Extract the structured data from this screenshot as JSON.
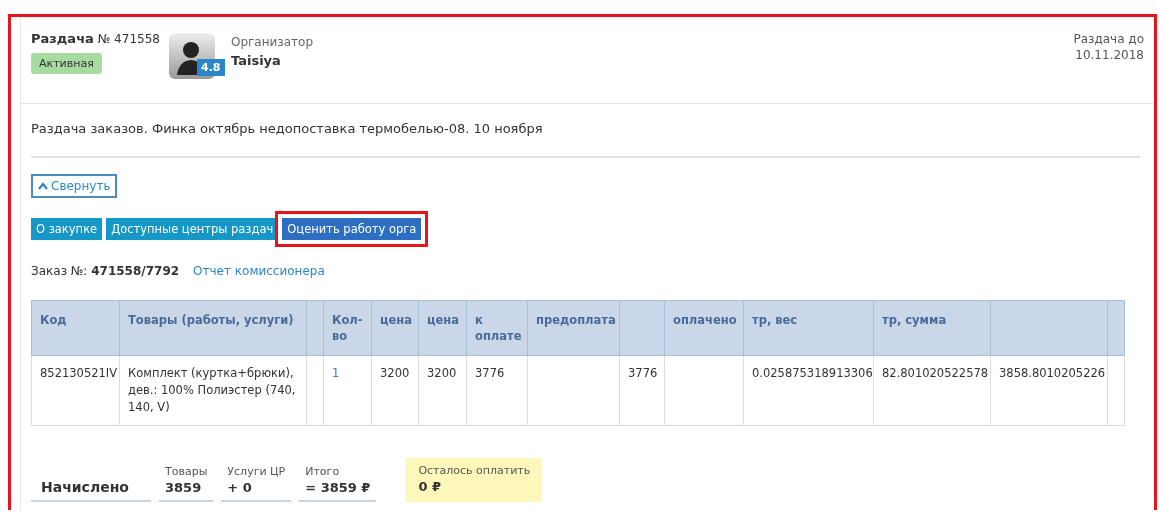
{
  "header": {
    "title": "Раздача",
    "number": "№ 471558",
    "status": "Активная",
    "organizer_label": "Организатор",
    "organizer_name": "Taisiya",
    "rating": "4.8",
    "deadline_label": "Раздача до",
    "deadline_date": "10.11.2018"
  },
  "description": "Раздача заказов. Финка октябрь недопоставка термобелью-08. 10 ноября",
  "collapse_button": "Свернуть",
  "buttons": [
    {
      "label": "О закупке",
      "highlighted": false
    },
    {
      "label": "Доступные центры раздач",
      "highlighted": false
    },
    {
      "label": "Оценить работу орга",
      "highlighted": true
    }
  ],
  "order": {
    "label": "Заказ №:",
    "number": "471558/7792",
    "link": "Отчет комиссионера"
  },
  "table": {
    "columns": [
      {
        "label": "Код"
      },
      {
        "label": "Товары (работы, услуги)"
      },
      {},
      {
        "label": "Кол-во"
      },
      {
        "label": "цена"
      },
      {
        "label": "цена"
      },
      {
        "label": "к оплате"
      },
      {
        "label": "предоплата"
      },
      {},
      {
        "label": "оплачено"
      },
      {
        "label": "тр, вес"
      },
      {
        "label": "тр, сумма"
      },
      {},
      {}
    ],
    "rows": [
      {
        "cells": [
          {
            "text": "852130521IV"
          },
          {
            "text": "Комплект (куртка+брюки), дев.: 100% Полиэстер (740, 140, V)"
          },
          {},
          {
            "text": "1",
            "kind": "link"
          },
          {
            "text": "3200"
          },
          {
            "text": "3200"
          },
          {
            "text": "3776"
          },
          {},
          {
            "text": "3776"
          },
          {},
          {
            "text": "0.025875318913306"
          },
          {
            "text": "82.801020522578"
          },
          {
            "text": "3858.8010205226"
          },
          {}
        ]
      }
    ]
  },
  "summary": {
    "title": "Начислено",
    "items": [
      {
        "label": "Товары",
        "value": "3859"
      },
      {
        "label": "Услуги ЦР",
        "value": "+ 0"
      },
      {
        "label": "Итого",
        "value": "= 3859 ₽"
      }
    ],
    "remaining_label": "Осталось оплатить",
    "remaining_value": "0 ₽"
  }
}
